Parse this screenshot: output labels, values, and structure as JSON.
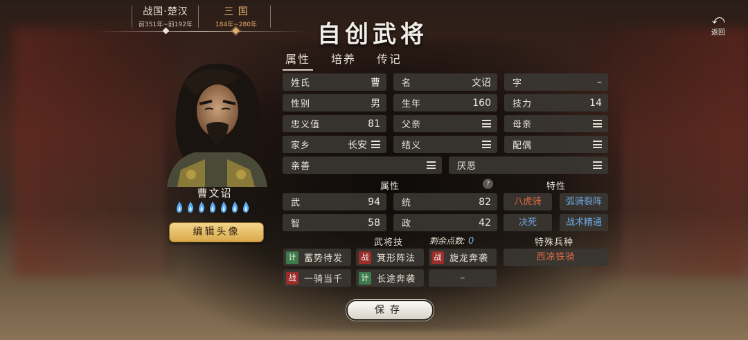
{
  "eras": [
    {
      "name": "战国·楚汉",
      "years": "前351年~前192年",
      "active": false
    },
    {
      "name": "三 国",
      "years": "184年~280年",
      "active": true
    }
  ],
  "title": "自创武将",
  "back_label": "返回",
  "tabs": [
    {
      "label": "属性",
      "active": true
    },
    {
      "label": "培养",
      "active": false
    },
    {
      "label": "传记",
      "active": false
    }
  ],
  "hero": {
    "name": "曹文诏",
    "star_count": 7,
    "edit_portrait_label": "编辑头像"
  },
  "basic": {
    "surname": {
      "label": "姓氏",
      "value": "曹"
    },
    "given_name": {
      "label": "名",
      "value": "文诏"
    },
    "courtesy": {
      "label": "字",
      "value": "–"
    },
    "gender": {
      "label": "性别",
      "value": "男"
    },
    "birth_year": {
      "label": "生年",
      "value": "160"
    },
    "skill_power": {
      "label": "技力",
      "value": "14"
    },
    "loyalty": {
      "label": "忠义值",
      "value": "81"
    },
    "father": {
      "label": "父亲"
    },
    "mother": {
      "label": "母亲"
    },
    "hometown": {
      "label": "家乡",
      "value": "长安"
    },
    "sworn": {
      "label": "结义"
    },
    "spouse": {
      "label": "配偶"
    },
    "likes": {
      "label": "亲善"
    },
    "dislikes": {
      "label": "厌恶"
    }
  },
  "attributes": {
    "heading": "属性",
    "help": "?",
    "wu": {
      "label": "武",
      "value": "94"
    },
    "tong": {
      "label": "统",
      "value": "82"
    },
    "zhi": {
      "label": "智",
      "value": "58"
    },
    "zheng": {
      "label": "政",
      "value": "42"
    }
  },
  "traits": {
    "heading": "特性",
    "items": [
      {
        "name": "八虎骑",
        "color": "#e06a44"
      },
      {
        "name": "弧骑裂阵",
        "color": "#6fa8e0"
      },
      {
        "name": "决死",
        "color": "#6fa8e0"
      },
      {
        "name": "战术精通",
        "color": "#6fa8e0"
      }
    ]
  },
  "skills": {
    "heading": "武将技",
    "remaining_label": "剩余点数:",
    "remaining_value": "0",
    "items": [
      {
        "type": "计",
        "kind": "ji",
        "name": "蓄势待发"
      },
      {
        "type": "战",
        "kind": "zhan",
        "name": "箕形阵法"
      },
      {
        "type": "战",
        "kind": "zhan",
        "name": "旋龙奔袭"
      },
      {
        "type": "战",
        "kind": "zhan",
        "name": "一骑当千"
      },
      {
        "type": "计",
        "kind": "ji",
        "name": "长途奔袭"
      }
    ],
    "empty_slot": "–"
  },
  "special_troop": {
    "heading": "特殊兵种",
    "name": "西凉铁骑"
  },
  "save_label": "保存"
}
